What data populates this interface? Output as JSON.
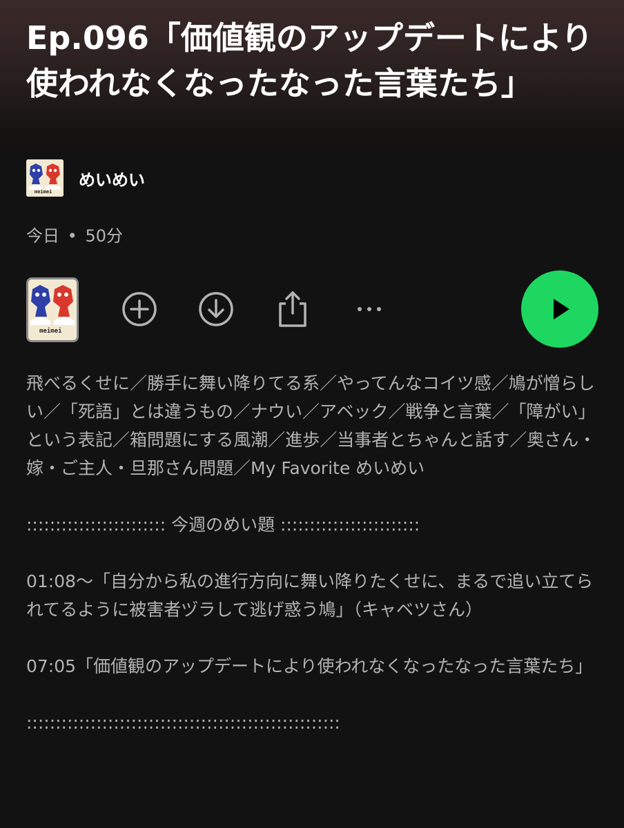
{
  "episode": {
    "title": "Ep.096「価値観のアップデートにより使われなくなったなった言葉たち」",
    "show_name": "めいめい",
    "date": "今日",
    "separator": "•",
    "duration": "50分",
    "artwork_text": "meimei"
  },
  "actions": {
    "add_icon": "plus-circle-icon",
    "download_icon": "download-circle-icon",
    "share_icon": "share-icon",
    "more_icon": "more-icon",
    "play_icon": "play-icon",
    "play_color": "#1ed760"
  },
  "description": {
    "topics": "飛べるくせに／勝手に舞い降りてる系／やってんなコイツ感／鳩が憎らしい／「死語」とは違うもの／ナウい／アベック／戦争と言葉／「障がい」という表記／箱問題にする風潮／進歩／当事者とちゃんと話す／奥さん・嫁・ご主人・旦那さん問題／My Favorite めいめい",
    "section_header": ":::::::::::::::::::::::: 今週のめい題 ::::::::::::::::::::::::",
    "item1": "01:08〜「自分から私の進行方向に舞い降りたくせに、まるで追い立てられてるように被害者ヅラして逃げ惑う鳩」（キャベツさん）",
    "item2": "07:05「価値観のアップデートにより使われなくなったなった言葉たち」",
    "divider": "::::::::::::::::::::::::::::::::::::::::::::::::::::::"
  }
}
